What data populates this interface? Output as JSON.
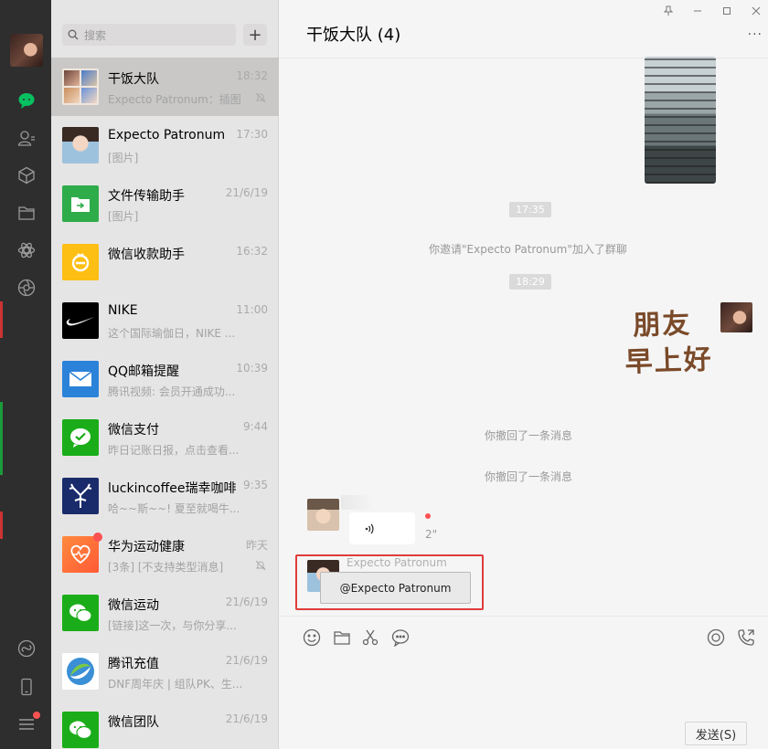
{
  "colors": {
    "sidebar_bg": "#2e2e2e",
    "list_bg": "#e6e5e5",
    "active_item": "#c9c8c7",
    "accent_green": "#07c160",
    "red_badge": "#fa5151",
    "highlight_red": "#e03b3b"
  },
  "nav": {
    "icons": [
      "avatar",
      "chat-icon",
      "contacts-icon",
      "favorites-icon",
      "files-icon",
      "moments-icon",
      "channels-icon",
      "mini-programs-icon",
      "phone-icon",
      "menu-icon"
    ]
  },
  "search": {
    "placeholder": "搜索",
    "add_label": "+"
  },
  "chats": [
    {
      "name": "干饭大队",
      "time": "18:32",
      "preview": "Expecto Patronum：插图",
      "muted": true,
      "active": true,
      "avatar": "group-avatar"
    },
    {
      "name": "Expecto Patronum",
      "time": "17:30",
      "preview": "[图片]",
      "avatar": "user-avatar"
    },
    {
      "name": "文件传输助手",
      "time": "21/6/19",
      "preview": "[图片]",
      "avatar": "file-transfer-icon"
    },
    {
      "name": "微信收款助手",
      "time": "16:32",
      "preview": "",
      "avatar": "payment-assistant-icon"
    },
    {
      "name": "NIKE",
      "time": "11:00",
      "preview": "这个国际瑜伽日，NIKE ...",
      "avatar": "nike-logo"
    },
    {
      "name": "QQ邮箱提醒",
      "time": "10:39",
      "preview": "腾讯视频: 会员开通成功...",
      "avatar": "mail-icon"
    },
    {
      "name": "微信支付",
      "time": "9:44",
      "preview": "昨日记账日报，点击查看...",
      "avatar": "wechat-pay-icon"
    },
    {
      "name": "luckincoffee瑞幸咖啡",
      "time": "9:35",
      "preview": "哈~~斯~~! 夏至就喝牛...",
      "avatar": "luckin-logo"
    },
    {
      "name": "华为运动健康",
      "time": "昨天",
      "preview": "[3条] [不支持类型消息]",
      "muted": true,
      "badge": true,
      "avatar": "health-icon"
    },
    {
      "name": "微信运动",
      "time": "21/6/19",
      "preview": "[链接]这一次，与你分享...",
      "avatar": "wechat-sport-icon"
    },
    {
      "name": "腾讯充值",
      "time": "21/6/19",
      "preview": "DNF周年庆 | 组队PK、生...",
      "avatar": "tencent-recharge-icon"
    },
    {
      "name": "微信团队",
      "time": "21/6/19",
      "preview": "",
      "avatar": "wechat-team-icon"
    }
  ],
  "main": {
    "title": "干饭大队 (4)",
    "more": "···",
    "window_controls": [
      "pin-icon",
      "minimize-icon",
      "maximize-icon",
      "close-icon"
    ],
    "time_1": "17:35",
    "system_invite": "你邀请\"Expecto Patronum\"加入了群聊",
    "time_2": "18:29",
    "sticker_text_line1": "朋友",
    "sticker_text_line2": "早上好",
    "recall_1": "你撤回了一条消息",
    "recall_2": "你撤回了一条消息",
    "voice_duration": "2\"",
    "mention_sender": "Expecto Patronum",
    "mention_text": "@Expecto Patronum",
    "send_label": "发送(S)"
  }
}
